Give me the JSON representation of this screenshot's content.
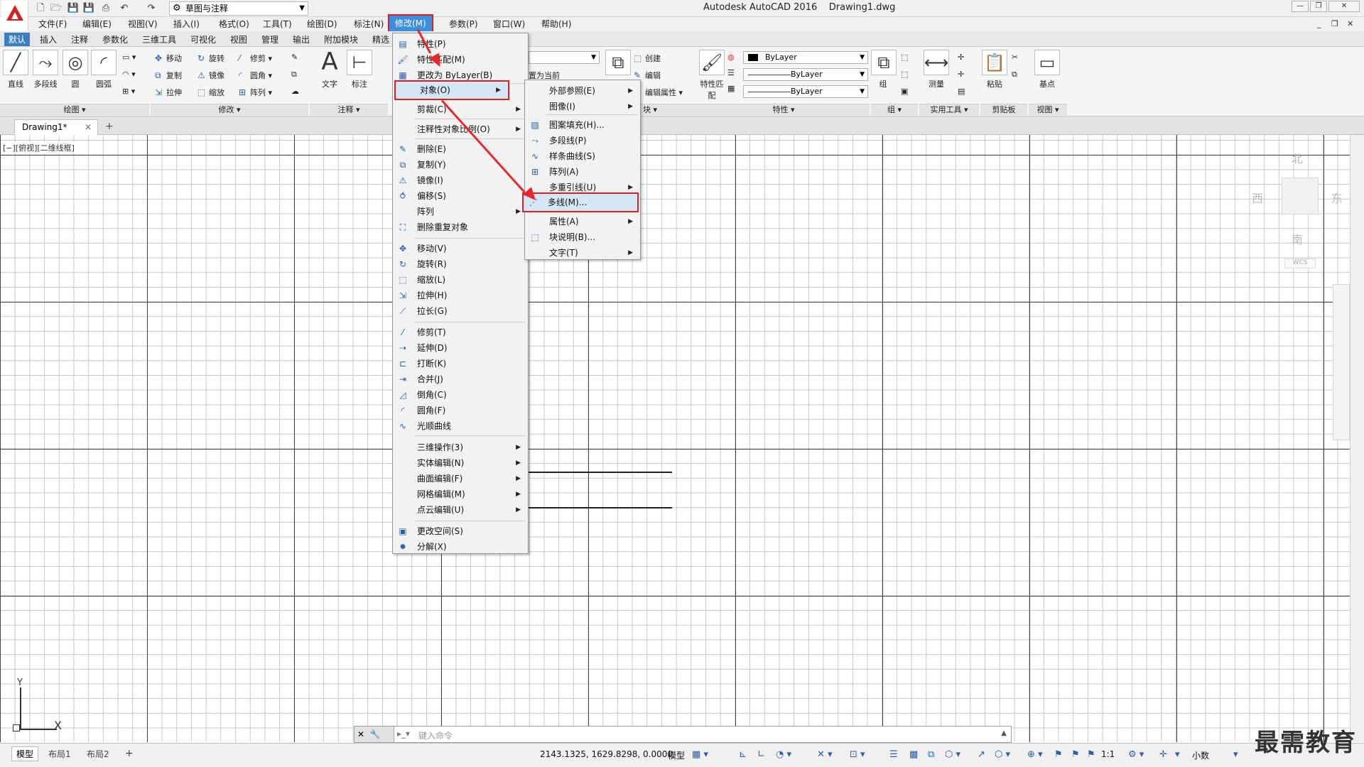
{
  "app": {
    "title": "Autodesk AutoCAD 2016",
    "document": "Drawing1.dwg",
    "workspace": "草图与注释"
  },
  "menubar": [
    "文件(F)",
    "编辑(E)",
    "视图(V)",
    "插入(I)",
    "格式(O)",
    "工具(T)",
    "绘图(D)",
    "标注(N)",
    "修改(M)",
    "参数(P)",
    "窗口(W)",
    "帮助(H)"
  ],
  "ribbon_tabs": [
    "默认",
    "插入",
    "注释",
    "参数化",
    "三维工具",
    "可视化",
    "视图",
    "管理",
    "输出",
    "附加模块",
    "精选"
  ],
  "ribbon": {
    "draw": {
      "line": "直线",
      "polyline": "多段线",
      "circle": "圆",
      "arc": "圆弧",
      "label": "绘图"
    },
    "modify": {
      "move": "移动",
      "rotate": "旋转",
      "trim": "修剪",
      "copy": "复制",
      "mirror": "镜像",
      "fillet": "圆角",
      "stretch": "拉伸",
      "scale": "缩放",
      "array": "阵列",
      "label": "修改"
    },
    "annotation": {
      "text": "文字",
      "dimension": "标注",
      "label": "注释"
    },
    "layers": {
      "set_current": "置为当前"
    },
    "block": {
      "create": "创建",
      "edit": "编辑",
      "edit_attr": "编辑属性",
      "label": "块"
    },
    "properties": {
      "match": "特性匹配",
      "color": "ByLayer",
      "linetype": "ByLayer",
      "lineweight": "ByLayer",
      "label": "特性"
    },
    "group": {
      "label": "组",
      "group": "组"
    },
    "utilities": {
      "measure": "测量",
      "label": "实用工具"
    },
    "clipboard": {
      "paste": "粘贴",
      "label": "剪贴板"
    },
    "view": {
      "base": "基点",
      "label": "视图"
    }
  },
  "filetab": {
    "name": "Drawing1*"
  },
  "viewport_label": "[−][俯视][二维线框]",
  "viewcube": {
    "north": "北",
    "south": "南",
    "east": "东",
    "west": "西",
    "wcs": "WCS"
  },
  "ucs": {
    "x": "X",
    "y": "Y"
  },
  "modify_menu": [
    {
      "label": "特性(P)",
      "icon": "properties-icon"
    },
    {
      "label": "特性匹配(M)",
      "icon": "match-icon"
    },
    {
      "label": "更改为 ByLayer(B)",
      "icon": "bylayer-icon"
    },
    {
      "label": "对象(O)",
      "icon": "",
      "submenu": true
    },
    {
      "label": "剪裁(C)",
      "icon": "",
      "submenu": true
    },
    {
      "label": "注释性对象比例(O)",
      "icon": "",
      "submenu": true
    },
    {
      "label": "删除(E)",
      "icon": "erase-icon"
    },
    {
      "label": "复制(Y)",
      "icon": "copy-icon"
    },
    {
      "label": "镜像(I)",
      "icon": "mirror-icon"
    },
    {
      "label": "偏移(S)",
      "icon": "offset-icon"
    },
    {
      "label": "阵列",
      "icon": "",
      "submenu": true
    },
    {
      "label": "删除重复对象",
      "icon": "overkill-icon"
    },
    {
      "label": "移动(V)",
      "icon": "move-icon"
    },
    {
      "label": "旋转(R)",
      "icon": "rotate-icon"
    },
    {
      "label": "缩放(L)",
      "icon": "scale-icon"
    },
    {
      "label": "拉伸(H)",
      "icon": "stretch-icon"
    },
    {
      "label": "拉长(G)",
      "icon": "lengthen-icon"
    },
    {
      "label": "修剪(T)",
      "icon": "trim-icon"
    },
    {
      "label": "延伸(D)",
      "icon": "extend-icon"
    },
    {
      "label": "打断(K)",
      "icon": "break-icon"
    },
    {
      "label": "合并(J)",
      "icon": "join-icon"
    },
    {
      "label": "倒角(C)",
      "icon": "chamfer-icon"
    },
    {
      "label": "圆角(F)",
      "icon": "fillet-icon"
    },
    {
      "label": "光顺曲线",
      "icon": "blend-icon"
    },
    {
      "label": "三维操作(3)",
      "icon": "",
      "submenu": true
    },
    {
      "label": "实体编辑(N)",
      "icon": "",
      "submenu": true
    },
    {
      "label": "曲面编辑(F)",
      "icon": "",
      "submenu": true
    },
    {
      "label": "网格编辑(M)",
      "icon": "",
      "submenu": true
    },
    {
      "label": "点云编辑(U)",
      "icon": "",
      "submenu": true
    },
    {
      "label": "更改空间(S)",
      "icon": "chspace-icon"
    },
    {
      "label": "分解(X)",
      "icon": "explode-icon"
    }
  ],
  "object_menu": [
    {
      "label": "外部参照(E)",
      "submenu": true
    },
    {
      "label": "图像(I)",
      "submenu": true
    },
    {
      "label": "图案填充(H)...",
      "icon": "hatch-icon"
    },
    {
      "label": "多段线(P)",
      "icon": "pedit-icon"
    },
    {
      "label": "样条曲线(S)",
      "icon": "spline-icon"
    },
    {
      "label": "阵列(A)",
      "icon": "array-icon"
    },
    {
      "label": "多重引线(U)",
      "submenu": true
    },
    {
      "label": "多线(M)...",
      "icon": "mline-icon"
    },
    {
      "label": "属性(A)",
      "submenu": true
    },
    {
      "label": "块说明(B)...",
      "icon": "block-desc-icon"
    },
    {
      "label": "文字(T)",
      "submenu": true
    }
  ],
  "command": {
    "placeholder": "键入命令"
  },
  "status": {
    "layout_tabs": [
      "模型",
      "布局1",
      "布局2"
    ],
    "coords": "2143.1325, 1629.8298, 0.0000",
    "space": "模型",
    "scale": "1:1",
    "units": "小数"
  },
  "watermark": "最需教育",
  "colors": {
    "accent": "#3c8fde",
    "highlight_border": "#e02020",
    "arrow": "#e8262b"
  }
}
